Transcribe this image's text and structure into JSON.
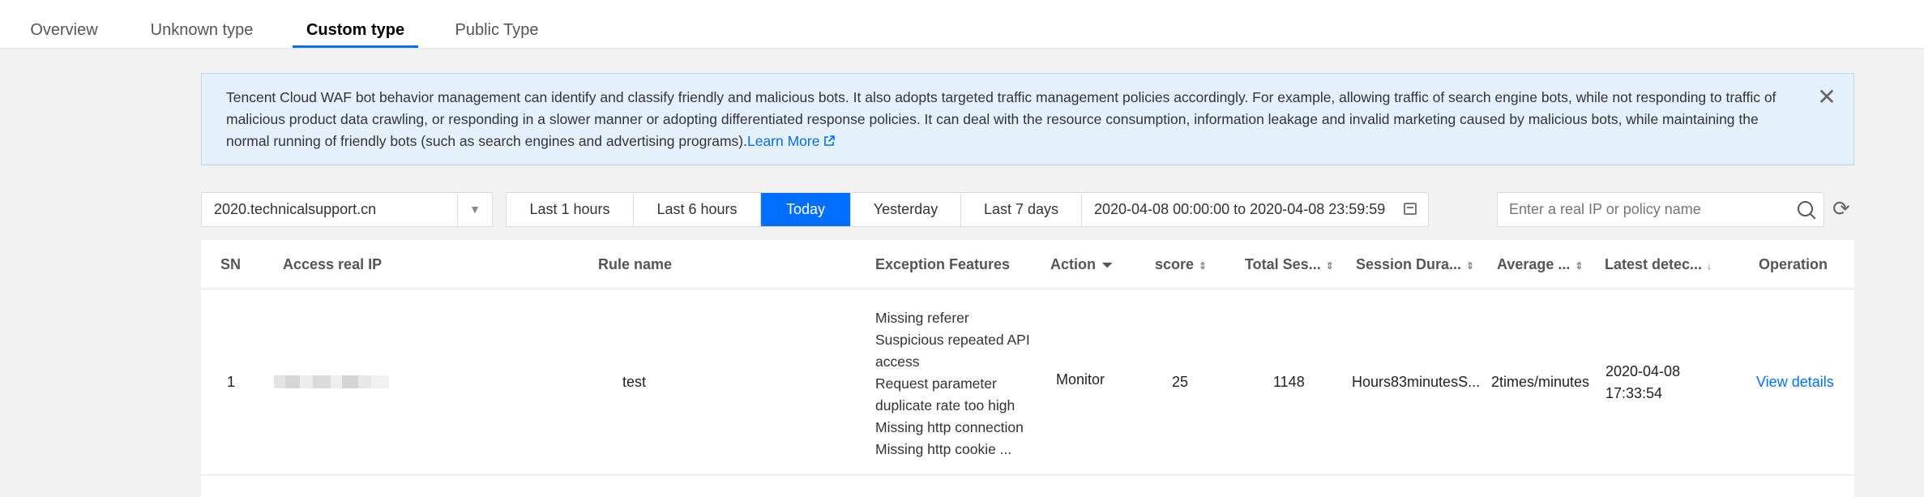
{
  "tabs": [
    {
      "label": "Overview",
      "active": false
    },
    {
      "label": "Unknown type",
      "active": false
    },
    {
      "label": "Custom type",
      "active": true
    },
    {
      "label": "Public Type",
      "active": false
    }
  ],
  "notice": {
    "text": "Tencent Cloud WAF bot behavior management can identify and classify friendly and malicious bots. It also adopts targeted traffic management policies accordingly. For example, allowing traffic of search engine bots, while not responding to traffic of malicious product data crawling, or responding in a slower manner or adopting differentiated response policies. It can deal with the resource consumption, information leakage and invalid marketing caused by malicious bots, while maintaining the normal running of friendly bots (such as search engines and advertising programs).",
    "link": "Learn More",
    "close_icon": "close-icon"
  },
  "filters": {
    "domain": "2020.technicalsupport.cn",
    "ranges": [
      {
        "label": "Last 1 hours",
        "active": false
      },
      {
        "label": "Last 6 hours",
        "active": false
      },
      {
        "label": "Today",
        "active": true
      },
      {
        "label": "Yesterday",
        "active": false
      },
      {
        "label": "Last 7 days",
        "active": false
      }
    ],
    "date_range": "2020-04-08 00:00:00 to 2020-04-08 23:59:59",
    "search_placeholder": "Enter a real IP or policy name"
  },
  "table": {
    "headers": {
      "sn": "SN",
      "ip": "Access real IP",
      "rule": "Rule name",
      "features": "Exception Features",
      "action": "Action",
      "score": "score",
      "total_sessions": "Total Ses...",
      "session_duration": "Session Dura...",
      "average": "Average ...",
      "latest": "Latest detec...",
      "operation": "Operation"
    },
    "rows": [
      {
        "sn": "1",
        "rule": "test",
        "features": [
          "Missing referer",
          "Suspicious repeated API",
          "access",
          "Request parameter",
          "duplicate rate too high",
          "Missing http connection",
          "Missing http cookie ..."
        ],
        "action": "Monitor",
        "score": "25",
        "total_sessions": "1148",
        "session_duration": "Hours83minutesS...",
        "average": "2times/minutes",
        "latest_date": "2020-04-08",
        "latest_time": "17:33:54",
        "operation": "View details"
      }
    ]
  },
  "colors": {
    "accent": "#006eff",
    "notice_bg": "#e5f0fd"
  }
}
